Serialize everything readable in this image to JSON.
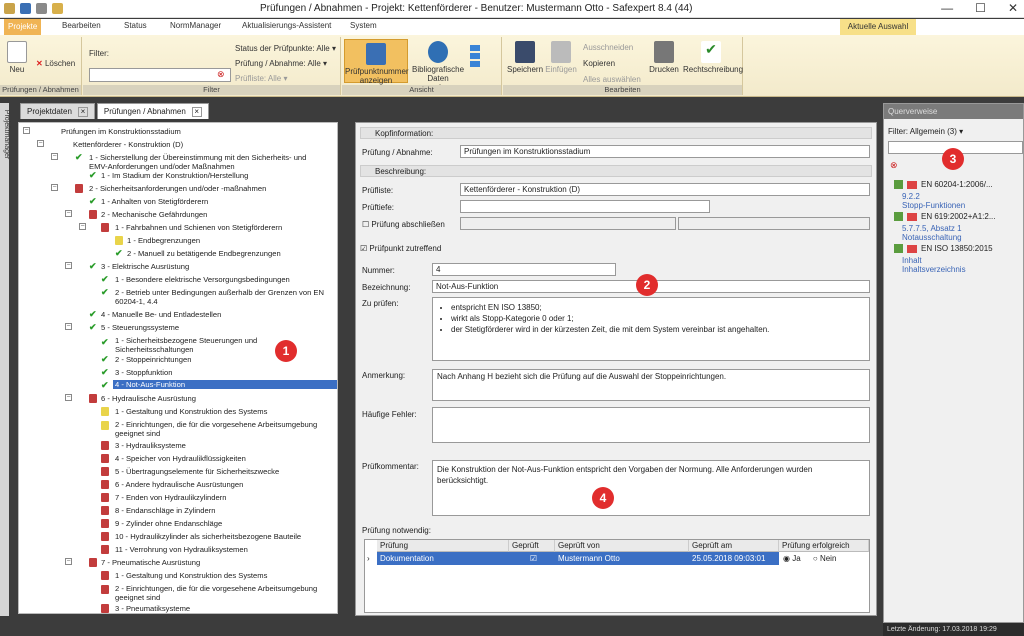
{
  "title": {
    "text": "Prüfungen / Abnahmen - Projekt: Kettenförderer  -  Benutzer: Mustermann Otto   -   Safexpert 8.4 (44)",
    "min": "—",
    "max": "☐",
    "close": "✕"
  },
  "tabs": [
    "Projekte",
    "Bearbeiten",
    "Status",
    "NormManager",
    "Aktualisierungs-Assistent",
    "System"
  ],
  "aktuelle": "Aktuelle Auswahl",
  "ribbon": {
    "neu": "Neu",
    "loeschen": "Löschen",
    "g1": "Prüfungen / Abnahmen",
    "filter_label": "Filter:",
    "status": "Status der Prüfpunkte: Alle ▾",
    "pruef": "Prüfung / Abnahme: Alle ▾",
    "pliste": "Prüfliste: Alle ▾",
    "g2": "Filter",
    "pnr": "Prüfpunktnummer anzeigen",
    "biblio": "Bibliografische Daten anzeigen",
    "g3": "Ansicht",
    "speichern": "Speichern",
    "einfuegen": "Einfügen",
    "ausschneiden": "Ausschneiden",
    "kopieren": "Kopieren",
    "alle": "Alles auswählen",
    "drucken": "Drucken",
    "recht": "Rechtschreibung",
    "g4": "Bearbeiten"
  },
  "vtab": "Projektmanager",
  "doctabs": [
    "Projektdaten",
    "Prüfungen / Abnahmen"
  ],
  "tree": [
    "Prüfungen im Konstruktionsstadium",
    "Kettenförderer - Konstruktion (D)",
    "1 - Sicherstellung der Übereinstimmung mit den Sicherheits- und EMV-Anforderungen und/oder Maßnahmen",
    "1 - Im Stadium der Konstruktion/Herstellung",
    "2 - Sicherheitsanforderungen und/oder -maßnahmen",
    "1 - Anhalten von Stetigförderern",
    "2 - Mechanische Gefährdungen",
    "1 - Fahrbahnen und Schienen von Stetigförderern",
    "1 - Endbegrenzungen",
    "2 - Manuell zu betätigende Endbegrenzungen",
    "3 - Elektrische Ausrüstung",
    "1 - Besondere elektrische Versorgungsbedingungen",
    "2 - Betrieb unter Bedingungen außerhalb der Grenzen von EN 60204-1, 4.4",
    "4 - Manuelle Be- und Entladestellen",
    "5 - Steuerungssysteme",
    "1 - Sicherheitsbezogene Steuerungen und Sicherheitsschaltungen",
    "2 - Stoppeinrichtungen",
    "3 - Stoppfunktion",
    "4 - Not-Aus-Funktion",
    "6 - Hydraulische Ausrüstung",
    "1 - Gestaltung und Konstruktion des Systems",
    "2 - Einrichtungen, die für die vorgesehene Arbeitsumgebung geeignet sind",
    "3 - Hydrauliksysteme",
    "4 - Speicher von Hydraulikflüssigkeiten",
    "5 - Übertragungselemente für Sicherheitszwecke",
    "6 - Andere hydraulische Ausrüstungen",
    "7 - Enden von Hydraulikzylindern",
    "8 - Endanschläge in Zylindern",
    "9 - Zylinder ohne Endanschläge",
    "10 - Hydraulikzylinder als sicherheitsbezogene Bauteile",
    "11 - Verrohrung von Hydrauliksystemen",
    "7 - Pneumatische Ausrüstung",
    "1 - Gestaltung und Konstruktion des Systems",
    "2 - Einrichtungen, die für die vorgesehene Arbeitsumgebung geeignet sind",
    "3 - Pneumatiksysteme"
  ],
  "center": {
    "kopf": "Kopfinformation:",
    "pa_label": "Prüfung / Abnahme:",
    "pa_value": "Prüfungen im Konstruktionsstadium",
    "beschreibung": "Beschreibung:",
    "pl_label": "Prüfliste:",
    "pl_value": "Kettenförderer - Konstruktion (D)",
    "pt_label": "Prüftiefe:",
    "abschliessen": "Prüfung abschließen",
    "zutreffend": "Prüfpunkt zutreffend",
    "nr_label": "Nummer:",
    "nr_value": "4",
    "bez_label": "Bezeichnung:",
    "bez_value": "Not-Aus-Funktion",
    "zu_label": "Zu prüfen:",
    "zu_items": [
      "entspricht EN ISO 13850;",
      "wirkt als Stopp-Kategorie 0 oder 1;",
      "der Stetigförderer wird in der kürzesten Zeit, die mit dem System vereinbar ist angehalten."
    ],
    "anm_label": "Anmerkung:",
    "anm_value": "Nach Anhang H bezieht sich die Prüfung auf die Auswahl der Stoppeinrichtungen.",
    "hf_label": "Häufige Fehler:",
    "pk_label": "Prüfkommentar:",
    "pk_value": "Die Konstruktion der Not-Aus-Funktion entspricht den Vorgaben der Normung. Alle Anforderungen wurden berücksichtigt.",
    "notw": "Prüfung notwendig:",
    "grid_headers": [
      "Prüfung",
      "Geprüft",
      "Geprüft von",
      "Geprüft am",
      "Prüfung erfolgreich"
    ],
    "grid_row": {
      "pruefung": "Dokumentation",
      "von": "Mustermann Otto",
      "am": "25.05.2018 09:03:01",
      "ja": "Ja",
      "nein": "Nein"
    }
  },
  "right": {
    "header": "Querverweise",
    "filter": "Filter: Allgemein (3) ▾",
    "refs": [
      {
        "norm": "EN 60204-1:2006/...",
        "clause": "9.2.2",
        "desc": "Stopp-Funktionen"
      },
      {
        "norm": "EN 619:2002+A1:2...",
        "clause": "5.7.7.5, Absatz 1",
        "desc": "Notausschaltung"
      },
      {
        "norm": "EN ISO 13850:2015",
        "clause": "Inhalt",
        "desc": "Inhaltsverzeichnis"
      }
    ],
    "status": "Letzte Änderung: 17.03.2018 19:29"
  },
  "badges": [
    "1",
    "2",
    "3",
    "4"
  ]
}
